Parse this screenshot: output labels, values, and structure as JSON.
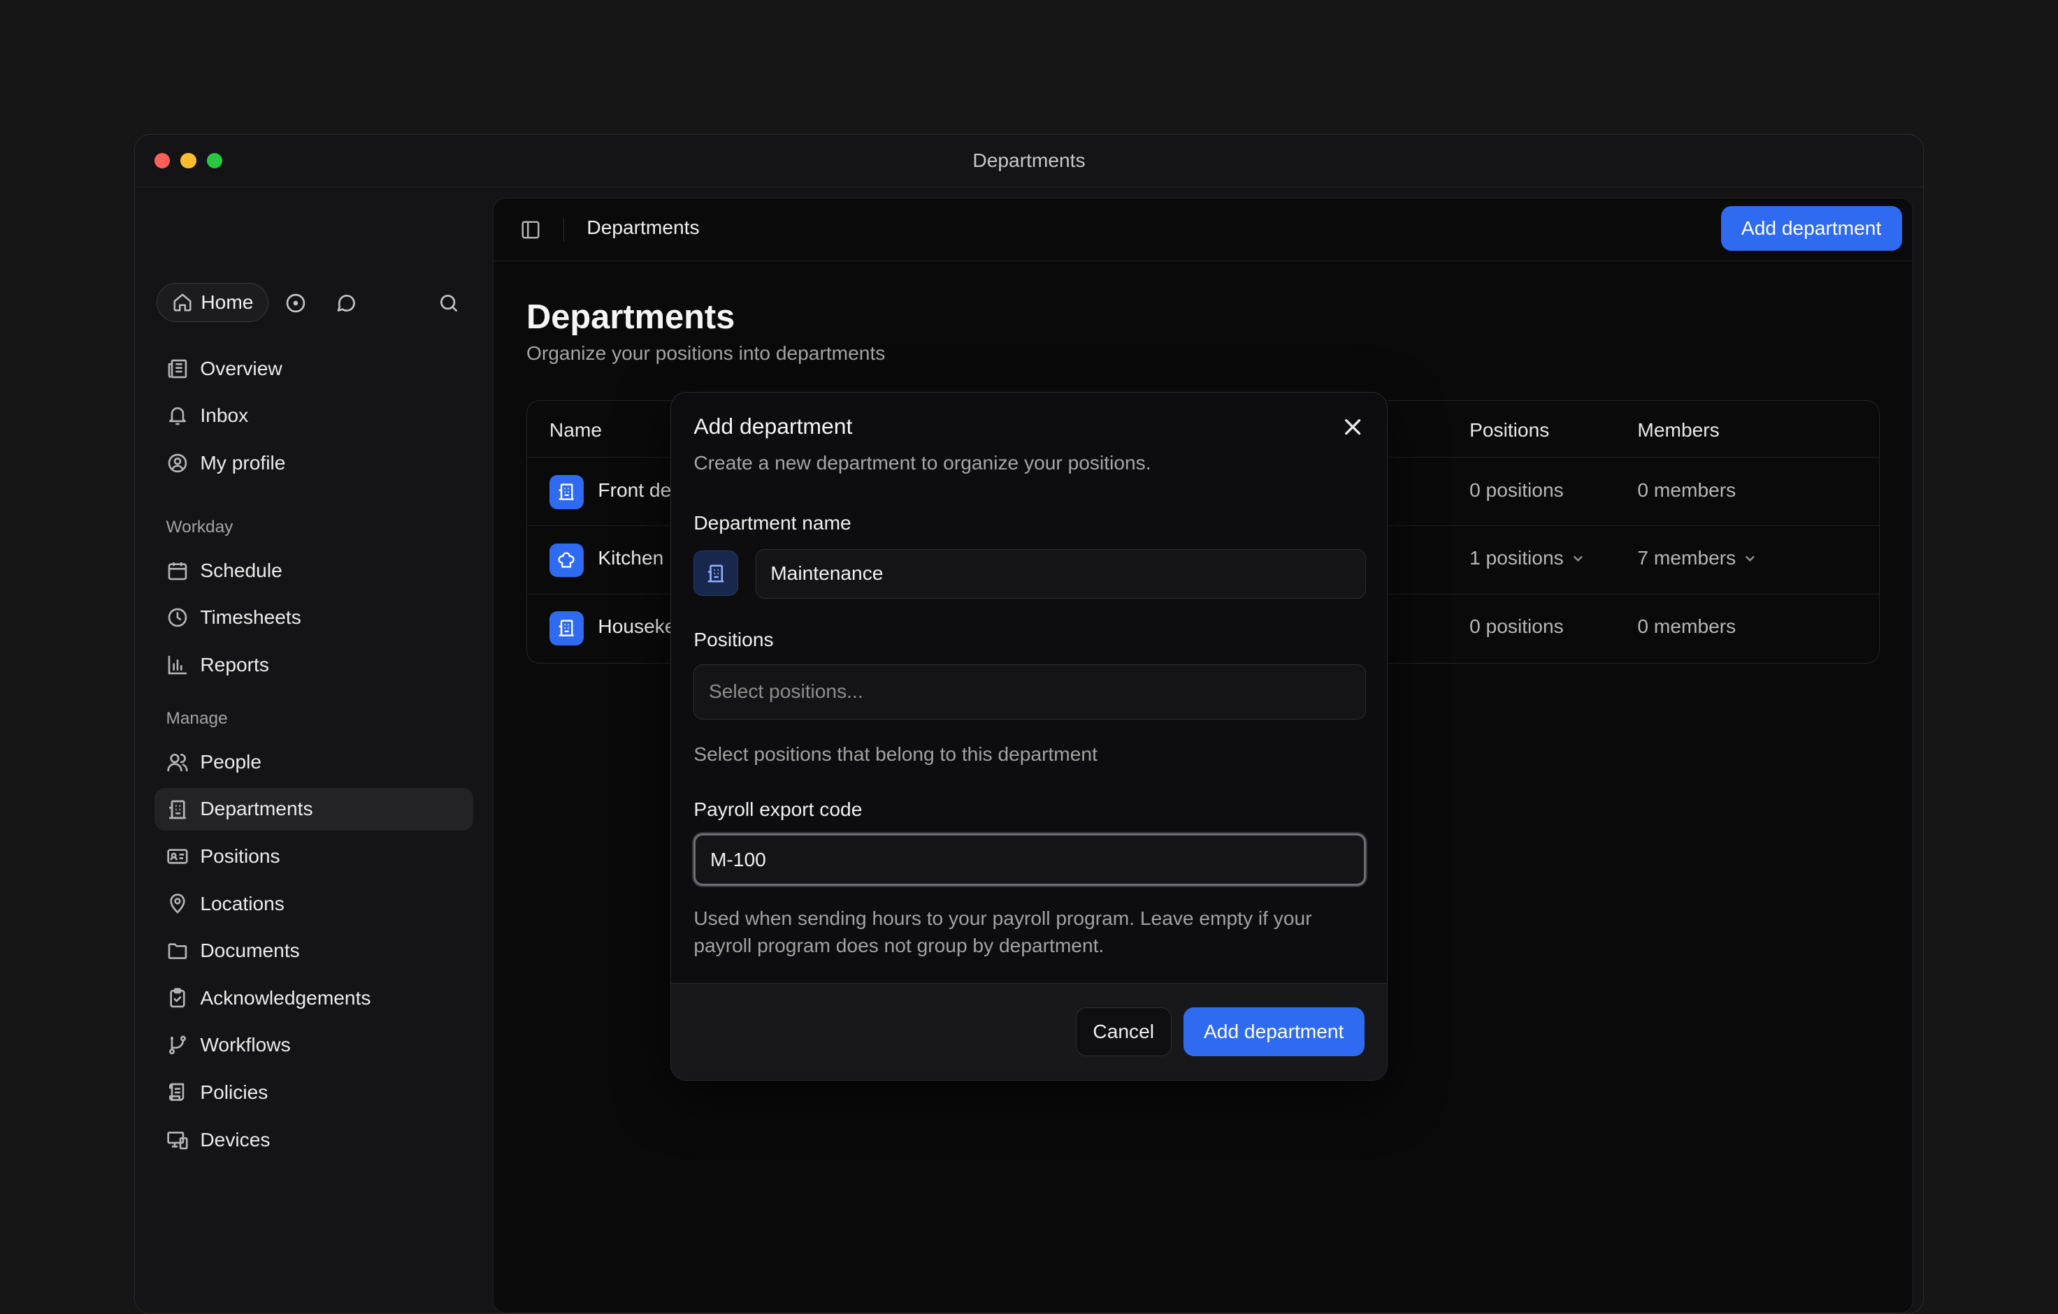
{
  "window": {
    "title": "Departments"
  },
  "colors": {
    "accent": "#2f6bf0",
    "close": "#ff5f57",
    "minimize": "#febc2e",
    "zoom": "#28c840"
  },
  "sidebar": {
    "home_label": "Home",
    "top_items": [
      {
        "label": "Overview",
        "icon": "newspaper-icon"
      },
      {
        "label": "Inbox",
        "icon": "bell-icon"
      },
      {
        "label": "My profile",
        "icon": "user-circle-icon"
      }
    ],
    "workday_label": "Workday",
    "workday_items": [
      {
        "label": "Schedule",
        "icon": "calendar-icon"
      },
      {
        "label": "Timesheets",
        "icon": "clock-icon"
      },
      {
        "label": "Reports",
        "icon": "bar-chart-icon"
      }
    ],
    "manage_label": "Manage",
    "manage_items": [
      {
        "label": "People",
        "icon": "users-icon"
      },
      {
        "label": "Departments",
        "icon": "building-icon"
      },
      {
        "label": "Positions",
        "icon": "id-card-icon"
      },
      {
        "label": "Locations",
        "icon": "map-pin-icon"
      },
      {
        "label": "Documents",
        "icon": "folder-icon"
      },
      {
        "label": "Acknowledgements",
        "icon": "clipboard-check-icon"
      },
      {
        "label": "Workflows",
        "icon": "git-branch-icon"
      },
      {
        "label": "Policies",
        "icon": "scroll-icon"
      },
      {
        "label": "Devices",
        "icon": "devices-icon"
      }
    ],
    "active_item": "Departments"
  },
  "header": {
    "title": "Departments",
    "add_button": "Add department"
  },
  "page": {
    "title": "Departments",
    "subtitle": "Organize your positions into departments"
  },
  "table": {
    "columns": {
      "name": "Name",
      "positions": "Positions",
      "members": "Members"
    },
    "rows": [
      {
        "name": "Front de",
        "positions": "0 positions",
        "members": "0 members",
        "icon": "building-icon"
      },
      {
        "name": "Kitchen",
        "positions": "1 positions",
        "members": "7 members",
        "icon": "chef-hat-icon"
      },
      {
        "name": "Houseke",
        "positions": "0 positions",
        "members": "0 members",
        "icon": "building-icon"
      }
    ]
  },
  "modal": {
    "title": "Add department",
    "subtitle": "Create a new department to organize your positions.",
    "name_label": "Department name",
    "name_value": "Maintenance",
    "positions_label": "Positions",
    "positions_placeholder": "Select positions...",
    "positions_help": "Select positions that belong to this department",
    "payroll_label": "Payroll export code",
    "payroll_value": "M-100",
    "payroll_help": "Used when sending hours to your payroll program. Leave empty if your payroll program does not group by department.",
    "cancel_label": "Cancel",
    "submit_label": "Add department"
  }
}
